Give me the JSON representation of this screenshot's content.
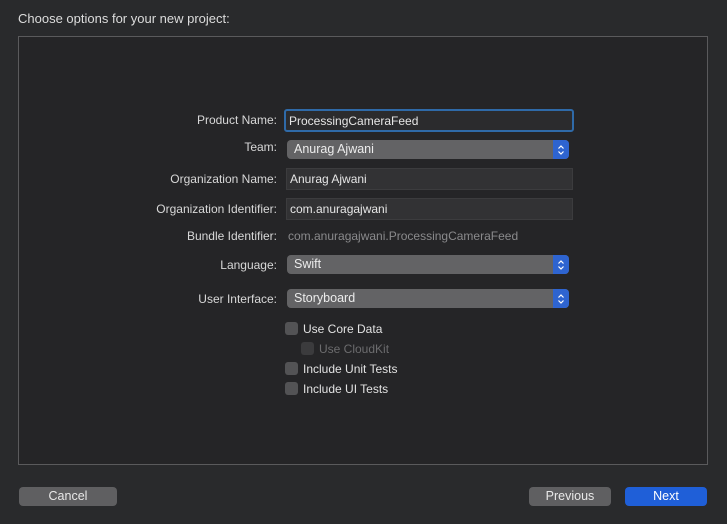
{
  "heading": "Choose options for your new project:",
  "form": {
    "product_name": {
      "label": "Product Name:",
      "value": "ProcessingCameraFeed"
    },
    "team": {
      "label": "Team:",
      "value": "Anurag Ajwani"
    },
    "organization_name": {
      "label": "Organization Name:",
      "value": "Anurag Ajwani"
    },
    "organization_identifier": {
      "label": "Organization Identifier:",
      "value": "com.anuragajwani"
    },
    "bundle_identifier": {
      "label": "Bundle Identifier:",
      "value": "com.anuragajwani.ProcessingCameraFeed"
    },
    "language": {
      "label": "Language:",
      "value": "Swift"
    },
    "user_interface": {
      "label": "User Interface:",
      "value": "Storyboard"
    }
  },
  "options": [
    {
      "label": "Use Core Data",
      "checked": false,
      "enabled": true
    },
    {
      "label": "Use CloudKit",
      "checked": false,
      "enabled": false
    },
    {
      "label": "Include Unit Tests",
      "checked": false,
      "enabled": true
    },
    {
      "label": "Include UI Tests",
      "checked": false,
      "enabled": true
    }
  ],
  "buttons": {
    "cancel": "Cancel",
    "previous": "Previous",
    "next": "Next"
  },
  "colors": {
    "accent": "#1f5fd8",
    "focus_ring": "#2f6aa8",
    "background": "#292a2c"
  }
}
